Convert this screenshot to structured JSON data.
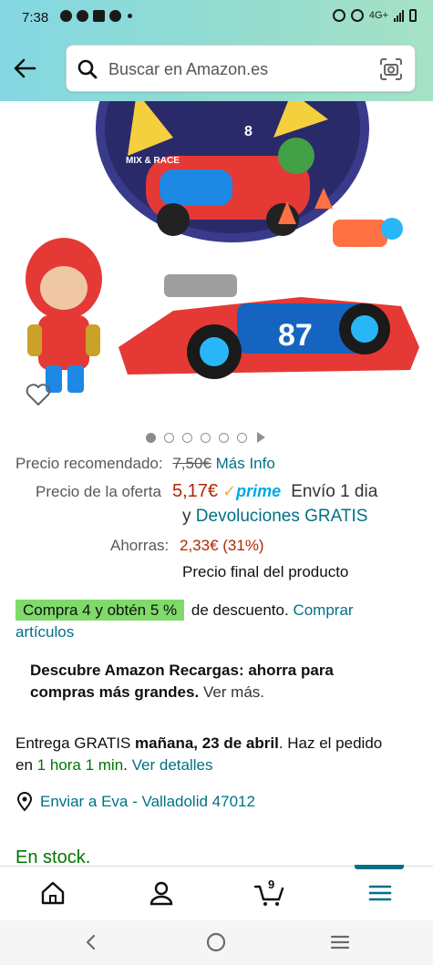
{
  "status_bar": {
    "time": "7:38",
    "network": "4G+"
  },
  "search": {
    "placeholder": "Buscar en Amazon.es"
  },
  "product_gallery": {
    "image_count": 6,
    "active_index": 0,
    "image_labels": [
      "MIX & RACE",
      "8",
      "87"
    ]
  },
  "pricing": {
    "recommended_label": "Precio recomendado:",
    "recommended_price": "7,50€",
    "more_info_link": "Más Info",
    "offer_label": "Precio de la oferta",
    "offer_price": "5,17€",
    "prime_label": "prime",
    "shipping_text": "Envío 1 dia",
    "returns_prefix": "y",
    "returns_link": "Devoluciones GRATIS",
    "savings_label": "Ahorras:",
    "savings_value": "2,33€ (31%)",
    "final_price_note": "Precio final del producto"
  },
  "deal": {
    "badge_text": "Compra 4 y obtén 5 %",
    "text": "de descuento.",
    "link_part1": "Comprar",
    "link_part2": "artículos"
  },
  "recargas": {
    "bold_line1": "Descubre Amazon Recargas: ahorra para",
    "bold_line2": "compras más grandes.",
    "link": "Ver más."
  },
  "delivery": {
    "prefix": "Entrega GRATIS",
    "date": "mañana, 23 de abril",
    "suffix": ". Haz el pedido",
    "en": "en",
    "countdown": "1 hora 1 min",
    "dot": ".",
    "details_link": "Ver detalles"
  },
  "address": {
    "text": "Enviar a Eva - Valladolid 47012"
  },
  "stock": {
    "text": "En stock."
  },
  "bottom_nav": {
    "cart_count": "9"
  },
  "colors": {
    "link": "#007185",
    "price_red": "#b12704",
    "prime_blue": "#00a8e1",
    "deal_green": "#7fda69",
    "stock_green": "#007600"
  }
}
